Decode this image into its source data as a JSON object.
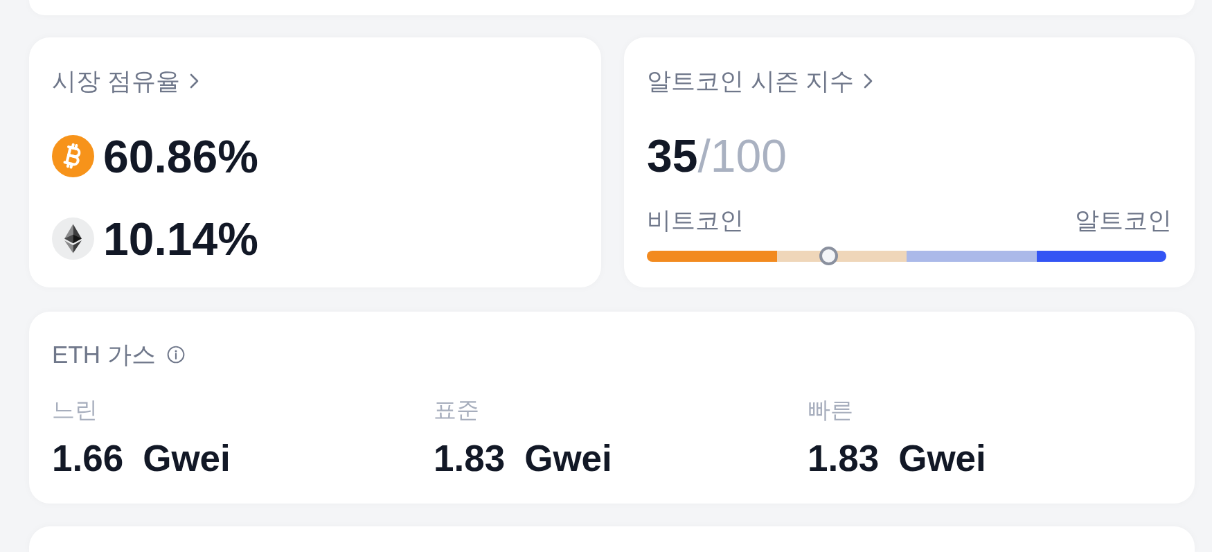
{
  "market_share": {
    "title": "시장 점유율",
    "coins": [
      {
        "kind": "btc",
        "share": "60.86%"
      },
      {
        "kind": "eth",
        "share": "10.14%"
      }
    ]
  },
  "altcoin_season": {
    "title": "알트코인 시즌 지수",
    "value": "35",
    "scale": "/100",
    "left_label": "비트코인",
    "right_label": "알트코인",
    "level": 0.35,
    "segments": [
      {
        "color": "#f28a1f"
      },
      {
        "color": "#efd6b9"
      },
      {
        "color": "#abb9e9"
      },
      {
        "color": "#3354f4"
      }
    ]
  },
  "eth_gas": {
    "title": "ETH 가스",
    "tiers": [
      {
        "label": "느린",
        "value": "1.66",
        "unit": "Gwei"
      },
      {
        "label": "표준",
        "value": "1.83",
        "unit": "Gwei"
      },
      {
        "label": "빠른",
        "value": "1.83",
        "unit": "Gwei"
      }
    ]
  }
}
